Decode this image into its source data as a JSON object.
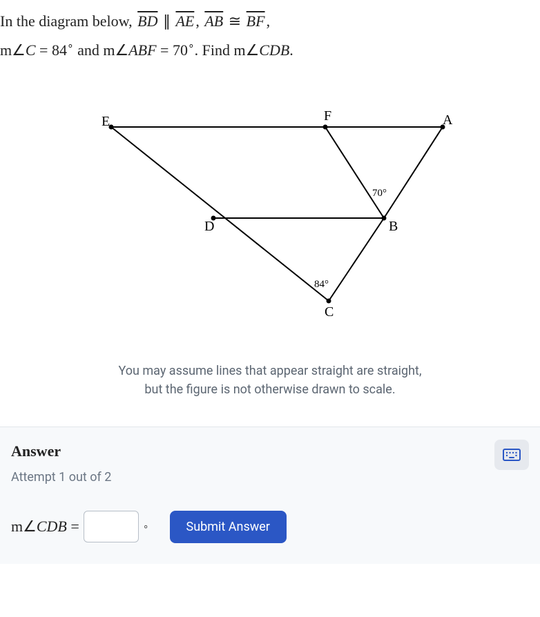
{
  "question": {
    "intro": "In the diagram below, ",
    "seg1": "BD",
    "parallel": " ∥ ",
    "seg2": "AE",
    "comma1": ", ",
    "seg3": "AB",
    "congruent": " ≅ ",
    "seg4": "BF",
    "comma2": ",",
    "m_prefix1": "m∠",
    "c_var": "C",
    "eq1": " = 84",
    "deg": "∘",
    "and": " and ",
    "m_prefix2": "m∠",
    "abf": "ABF",
    "eq2": " = 70",
    "period_find": ". Find ",
    "m_prefix3": "m∠",
    "cdb": "CDB",
    "period": "."
  },
  "diagram": {
    "labels": {
      "E": "E",
      "F": "F",
      "A": "A",
      "D": "D",
      "B": "B",
      "C": "C",
      "angle70": "70°",
      "angle84": "84°"
    }
  },
  "note": {
    "line1": "You may assume lines that appear straight are straight,",
    "line2": "but the figure is not otherwise drawn to scale."
  },
  "answer": {
    "title": "Answer",
    "attempt": "Attempt 1 out of 2",
    "label_m": "m∠",
    "label_cdb": "CDB",
    "label_eq": " =",
    "value": "",
    "unit": "∘",
    "submit": "Submit Answer"
  }
}
